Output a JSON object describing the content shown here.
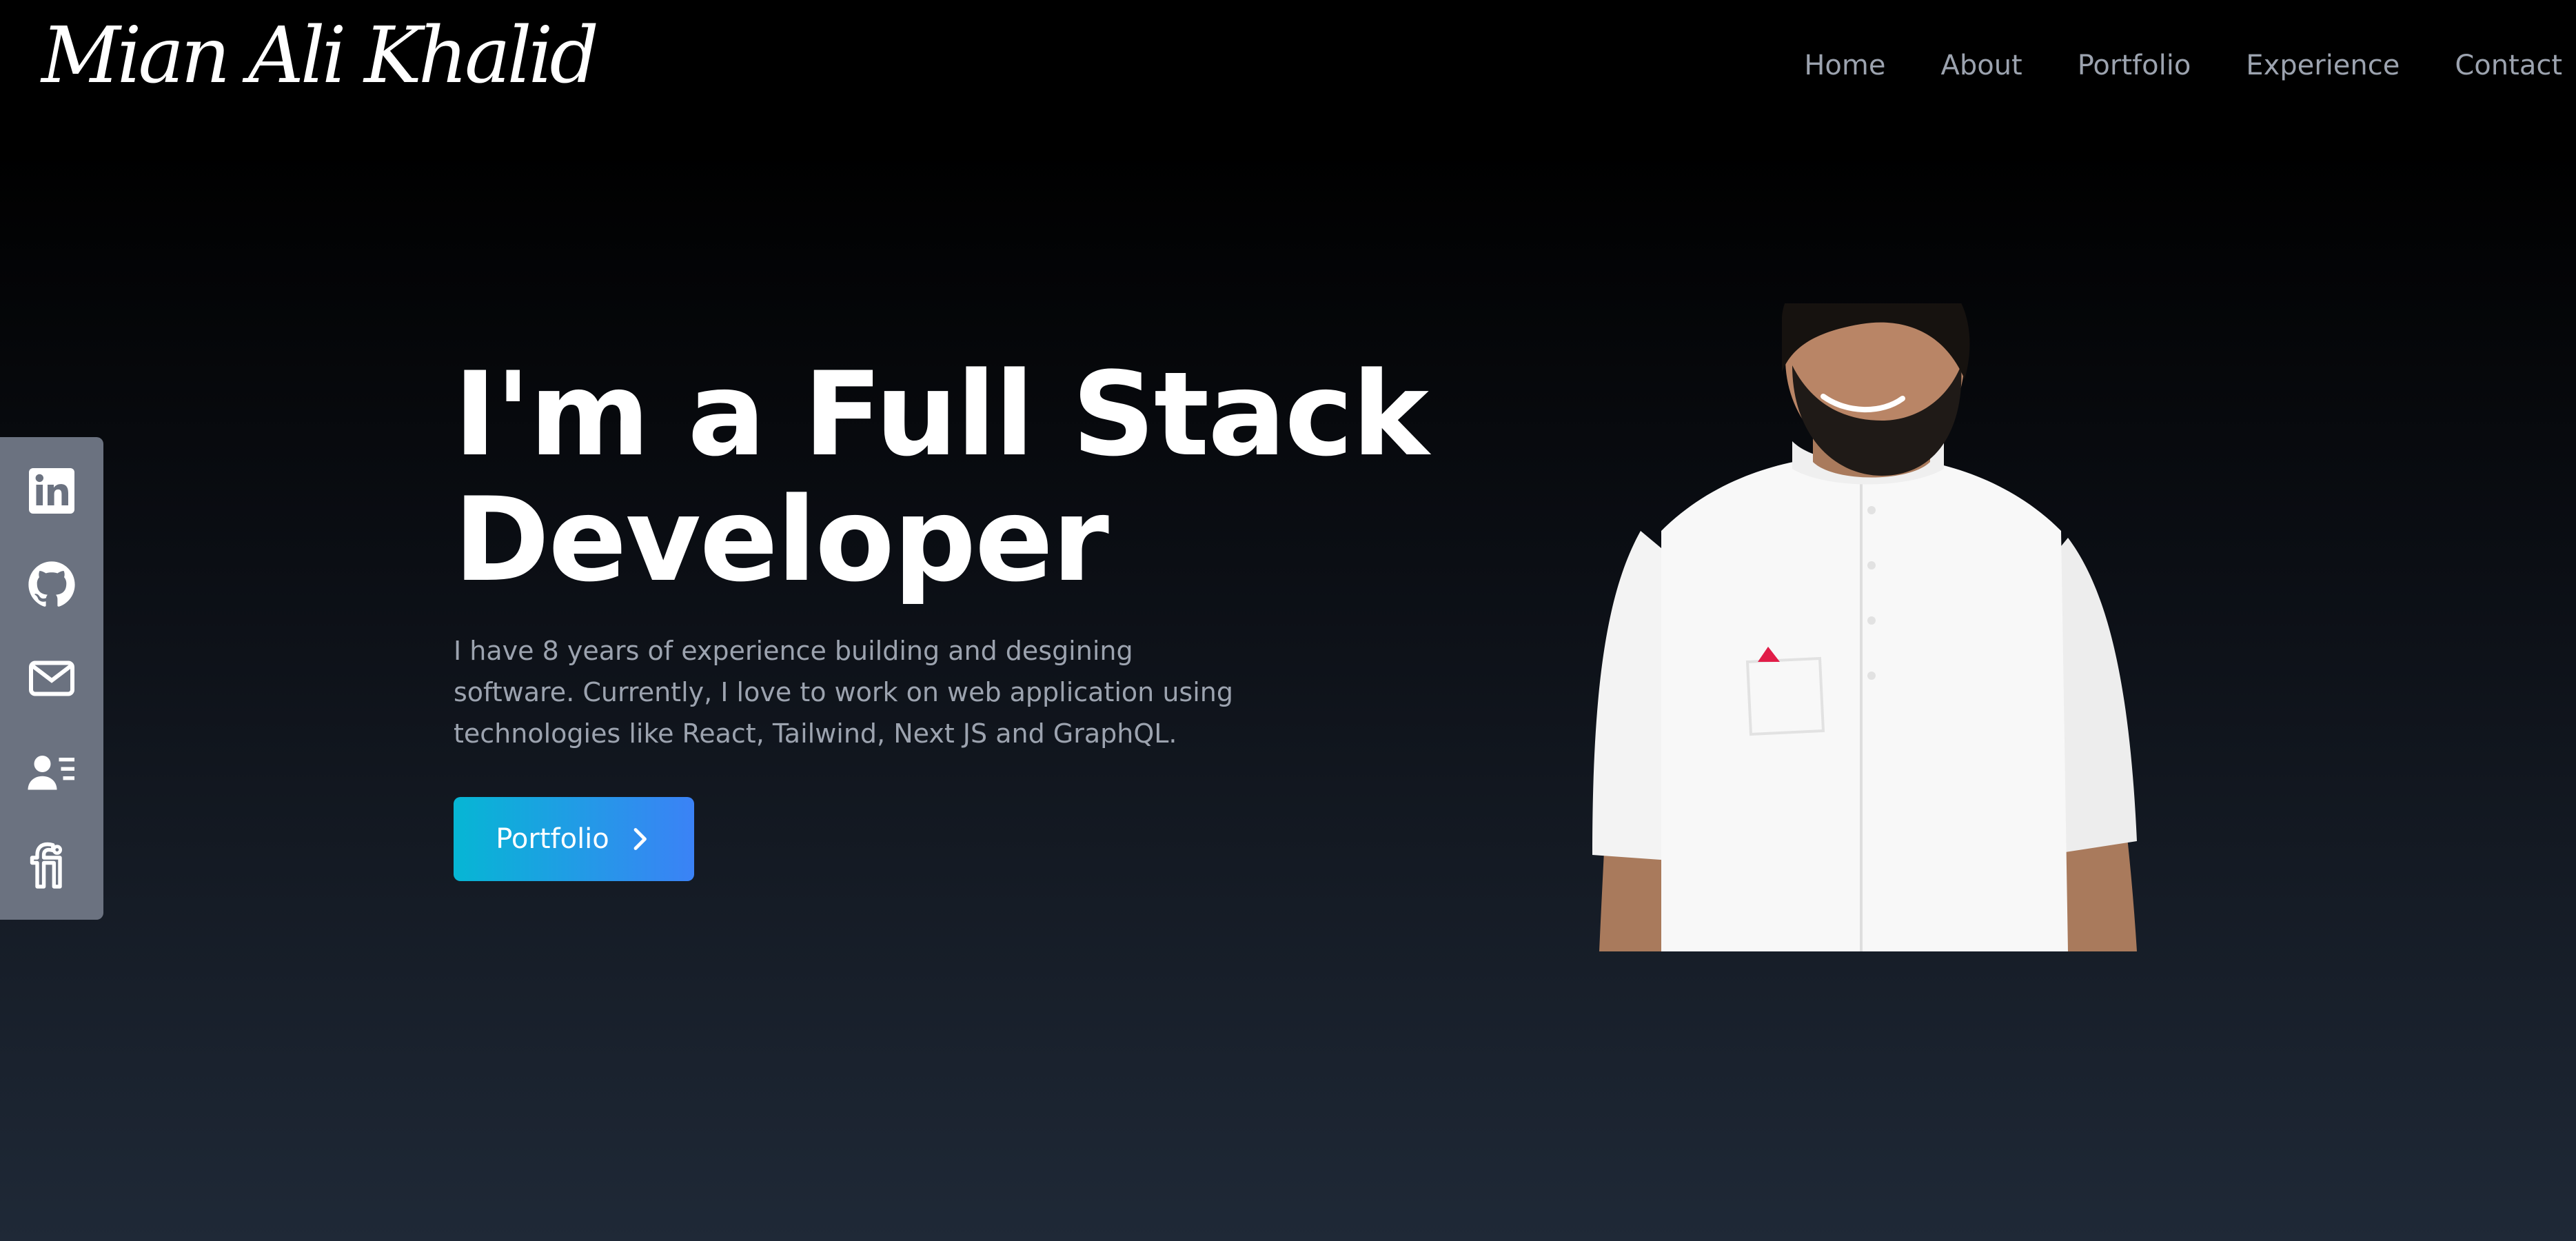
{
  "brand": {
    "logo_text": "Mian Ali Khalid"
  },
  "nav": {
    "items": [
      {
        "label": "Home"
      },
      {
        "label": "About"
      },
      {
        "label": "Portfolio"
      },
      {
        "label": "Experience"
      },
      {
        "label": "Contact"
      }
    ]
  },
  "social": {
    "items": [
      {
        "icon": "linkedin-icon"
      },
      {
        "icon": "github-icon"
      },
      {
        "icon": "mail-icon"
      },
      {
        "icon": "resume-icon"
      },
      {
        "icon": "fiverr-icon"
      }
    ]
  },
  "hero": {
    "heading_line1": "I'm a Full Stack",
    "heading_line2": "Developer",
    "description": "I have 8 years of experience building and desgining software. Currently, I love to work on web application using technologies like React, Tailwind, Next JS and GraphQL.",
    "cta_label": "Portfolio",
    "cta_icon": "chevron-right-icon"
  },
  "colors": {
    "background_top": "#000000",
    "background_bottom": "#1f2937",
    "sidebar": "#6b7280",
    "nav_text": "#9ca3af",
    "button_start": "#06b6d4",
    "button_end": "#3b82f6"
  }
}
